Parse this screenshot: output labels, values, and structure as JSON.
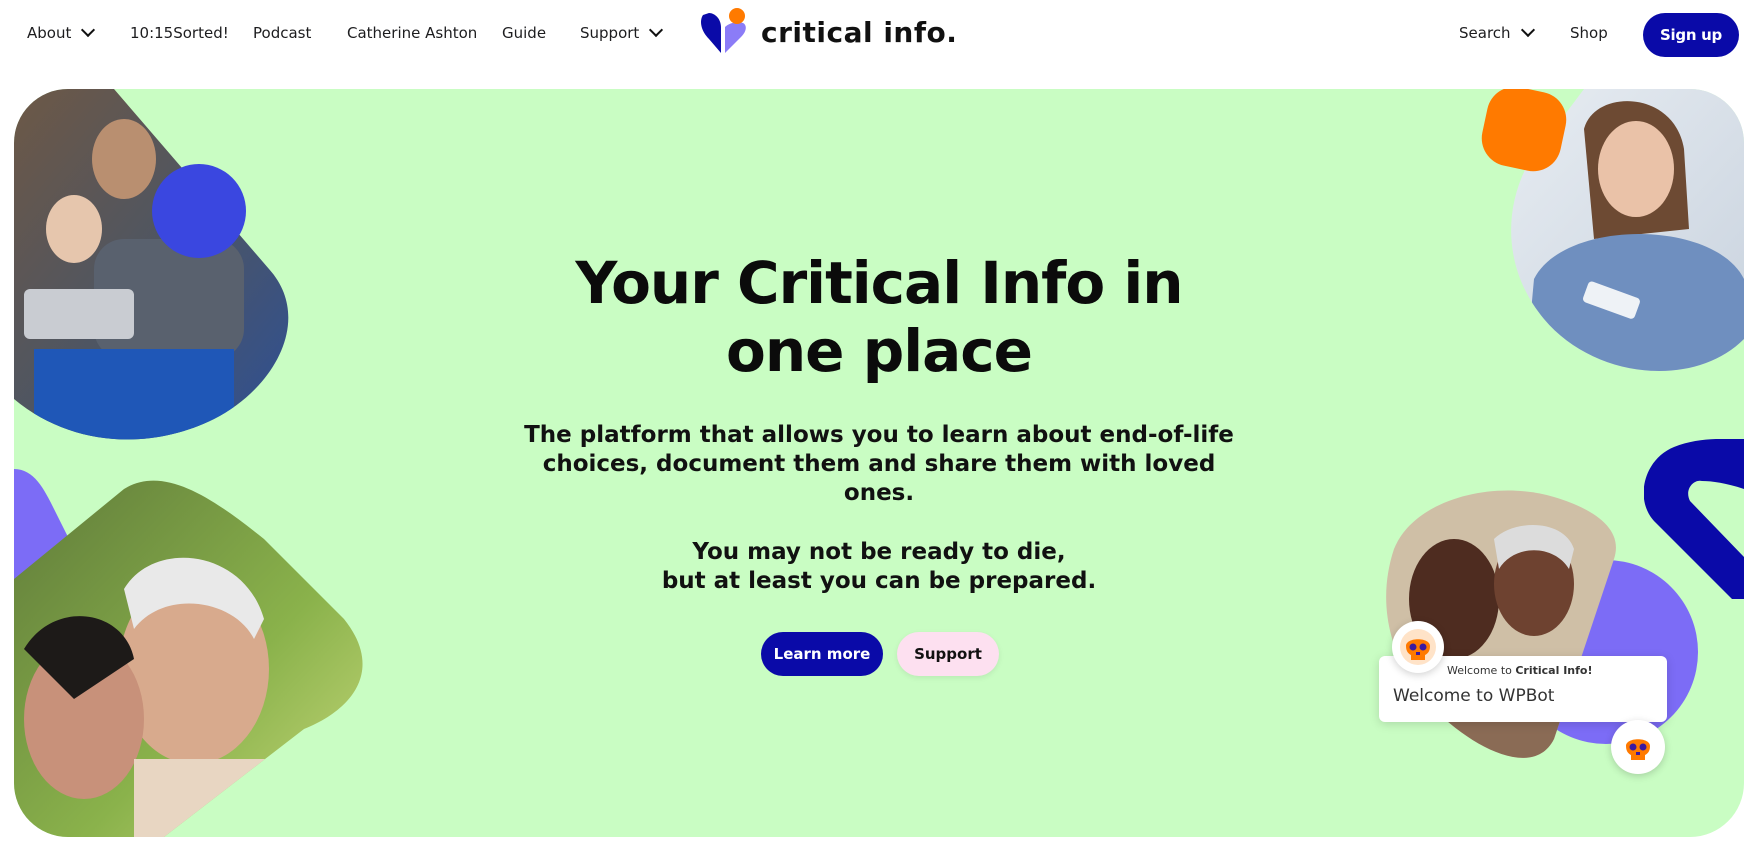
{
  "nav": {
    "left_items": [
      {
        "label": "About",
        "has_dropdown": true
      },
      {
        "label": "10:15Sorted!",
        "has_dropdown": false
      },
      {
        "label": "Podcast",
        "has_dropdown": false
      },
      {
        "label": "Catherine Ashton",
        "has_dropdown": false
      },
      {
        "label": "Guide",
        "has_dropdown": false
      },
      {
        "label": "Support",
        "has_dropdown": true
      }
    ],
    "logo_text": "critical info.",
    "right_items": [
      {
        "label": "Search",
        "has_dropdown": true
      },
      {
        "label": "Shop",
        "has_dropdown": false
      }
    ],
    "signup_label": "Sign up"
  },
  "hero": {
    "title": "Your Critical Info in one place",
    "subtitle": "The platform that allows you to learn about end-of-life choices, document them and share them with loved ones.",
    "tagline_line1": "You may not be ready to die,",
    "tagline_line2": "but at least you can be prepared.",
    "primary_button": "Learn more",
    "secondary_button": "Support"
  },
  "chat_widget": {
    "welcome_prefix": "Welcome to ",
    "welcome_brand": "Critical Info!",
    "message": "Welcome to WPBot",
    "avatar_icon": "skull-bot-icon"
  },
  "colors": {
    "hero_bg": "#c9fdc3",
    "brand_blue": "#0a0aa8",
    "accent_orange": "#ff7a00",
    "accent_purple": "#7c6cf6",
    "accent_blue_circle": "#3a47e0",
    "support_pink": "#fde0f0"
  },
  "icons": {
    "chevron": "chevron-down-icon",
    "logo": "heart-logo-icon"
  }
}
